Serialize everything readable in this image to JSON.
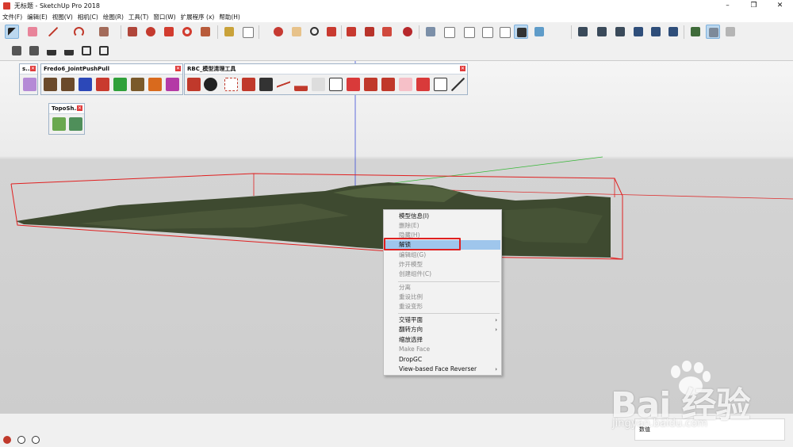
{
  "window": {
    "title": "无标题 - SketchUp Pro 2018",
    "controls": [
      "–",
      "❐",
      "✕"
    ]
  },
  "menu": [
    "文件(F)",
    "编辑(E)",
    "视图(V)",
    "相机(C)",
    "绘图(R)",
    "工具(T)",
    "窗口(W)",
    "扩展程序 (x)",
    "帮助(H)"
  ],
  "panels": {
    "small": {
      "title": "s..."
    },
    "fredo": {
      "title": "Fredo6_JointPushPull"
    },
    "rbc": {
      "title": "RBC_模型清理工具"
    },
    "topo": {
      "title": "TopoSh..."
    }
  },
  "context_menu": {
    "items": [
      {
        "label": "模型信息(I)",
        "enabled": true
      },
      {
        "label": "删除(E)",
        "enabled": false
      },
      {
        "label": "隐藏(H)",
        "enabled": false
      },
      {
        "label": "解锁",
        "enabled": true,
        "highlighted": true
      },
      {
        "label": "编辑组(G)",
        "enabled": false
      },
      {
        "label": "炸开模型",
        "enabled": false
      },
      {
        "label": "创建组件(C)",
        "enabled": false
      },
      {
        "label": "分离",
        "enabled": false
      },
      {
        "label": "重设比例",
        "enabled": false
      },
      {
        "label": "重设变形",
        "enabled": false
      },
      {
        "label": "交错平面",
        "enabled": true,
        "submenu": true
      },
      {
        "label": "翻转方向",
        "enabled": true,
        "submenu": true
      },
      {
        "label": "缩放选择",
        "enabled": true
      },
      {
        "label": "Make Face",
        "enabled": false
      },
      {
        "label": "DropGC",
        "enabled": true
      },
      {
        "label": "View-based Face Reverser",
        "enabled": true,
        "submenu": true
      }
    ],
    "submenu_arrow": "›"
  },
  "status": {
    "measurements_label": "数值"
  },
  "watermark": {
    "logo": "Bai 经验",
    "url": "jingyan.baidu.com"
  },
  "colors": {
    "selection_box": "#e02020",
    "highlight": "#9fc6ec",
    "terrain": "#3e4a30",
    "sky": "#f4f4f4",
    "ground": "#cfcfcf"
  }
}
